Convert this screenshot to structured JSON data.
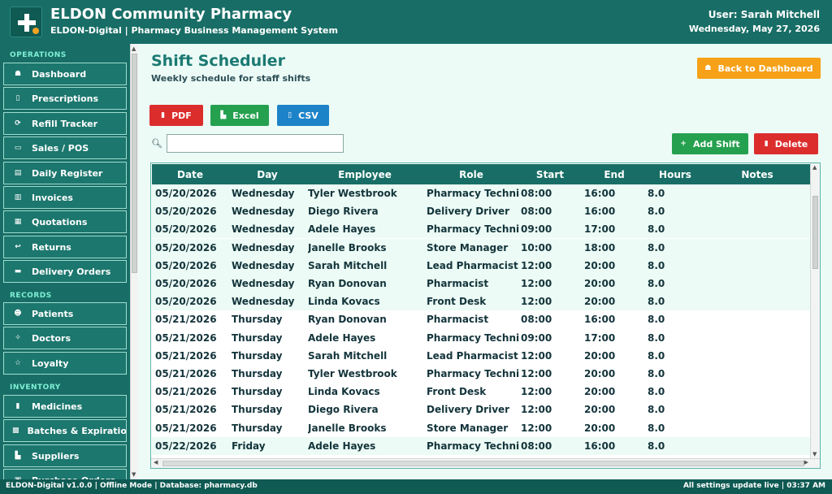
{
  "header": {
    "title": "ELDON Community Pharmacy",
    "subtitle": "ELDON-Digital  |  Pharmacy Business Management System",
    "user": "User: Sarah Mitchell",
    "date": "Wednesday, May 27, 2026"
  },
  "sidebar": {
    "sections": [
      {
        "label": "OPERATIONS",
        "items": [
          {
            "label": "Dashboard",
            "icon": "home-icon",
            "glyph": "☗"
          },
          {
            "label": "Prescriptions",
            "icon": "clipboard-icon",
            "glyph": "▯"
          },
          {
            "label": "Refill Tracker",
            "icon": "refresh-icon",
            "glyph": "⟳"
          },
          {
            "label": "Sales / POS",
            "icon": "register-icon",
            "glyph": "▭"
          },
          {
            "label": "Daily Register",
            "icon": "book-icon",
            "glyph": "▤"
          },
          {
            "label": "Invoices",
            "icon": "invoice-icon",
            "glyph": "▥"
          },
          {
            "label": "Quotations",
            "icon": "quote-icon",
            "glyph": "▦"
          },
          {
            "label": "Returns",
            "icon": "return-arrow-icon",
            "glyph": "↩"
          },
          {
            "label": "Delivery Orders",
            "icon": "truck-icon",
            "glyph": "▬"
          }
        ]
      },
      {
        "label": "RECORDS",
        "items": [
          {
            "label": "Patients",
            "icon": "users-icon",
            "glyph": "☻"
          },
          {
            "label": "Doctors",
            "icon": "stethoscope-icon",
            "glyph": "✧"
          },
          {
            "label": "Loyalty",
            "icon": "star-icon",
            "glyph": "☆"
          }
        ]
      },
      {
        "label": "INVENTORY",
        "items": [
          {
            "label": "Medicines",
            "icon": "pill-icon",
            "glyph": "▮"
          },
          {
            "label": "Batches & Expiration",
            "icon": "boxes-icon",
            "glyph": "▩"
          },
          {
            "label": "Suppliers",
            "icon": "chart-icon",
            "glyph": "▙"
          },
          {
            "label": "Purchase Orders",
            "icon": "cart-icon",
            "glyph": "▣"
          }
        ]
      }
    ]
  },
  "main": {
    "title": "Shift Scheduler",
    "subtitle": "Weekly schedule for staff shifts",
    "back_label": "Back to Dashboard",
    "export": {
      "pdf": "PDF",
      "excel": "Excel",
      "csv": "CSV"
    },
    "search": {
      "value": "",
      "placeholder": ""
    },
    "add_label": "Add Shift",
    "delete_label": "Delete"
  },
  "table": {
    "columns": [
      "Date",
      "Day",
      "Employee",
      "Role",
      "Start",
      "End",
      "Hours",
      "Notes"
    ],
    "rows": [
      [
        "05/20/2026",
        "Wednesday",
        "Tyler Westbrook",
        "Pharmacy Technician",
        "08:00",
        "16:00",
        "8.0",
        ""
      ],
      [
        "05/20/2026",
        "Wednesday",
        "Diego Rivera",
        "Delivery Driver",
        "08:00",
        "16:00",
        "8.0",
        ""
      ],
      [
        "05/20/2026",
        "Wednesday",
        "Adele Hayes",
        "Pharmacy Technician",
        "09:00",
        "17:00",
        "8.0",
        ""
      ],
      [
        "05/20/2026",
        "Wednesday",
        "Janelle Brooks",
        "Store Manager",
        "10:00",
        "18:00",
        "8.0",
        ""
      ],
      [
        "05/20/2026",
        "Wednesday",
        "Sarah Mitchell",
        "Lead Pharmacist",
        "12:00",
        "20:00",
        "8.0",
        ""
      ],
      [
        "05/20/2026",
        "Wednesday",
        "Ryan Donovan",
        "Pharmacist",
        "12:00",
        "20:00",
        "8.0",
        ""
      ],
      [
        "05/20/2026",
        "Wednesday",
        "Linda Kovacs",
        "Front Desk",
        "12:00",
        "20:00",
        "8.0",
        ""
      ],
      [
        "05/21/2026",
        "Thursday",
        "Ryan Donovan",
        "Pharmacist",
        "08:00",
        "16:00",
        "8.0",
        ""
      ],
      [
        "05/21/2026",
        "Thursday",
        "Adele Hayes",
        "Pharmacy Technician",
        "09:00",
        "17:00",
        "8.0",
        ""
      ],
      [
        "05/21/2026",
        "Thursday",
        "Sarah Mitchell",
        "Lead Pharmacist",
        "12:00",
        "20:00",
        "8.0",
        ""
      ],
      [
        "05/21/2026",
        "Thursday",
        "Tyler Westbrook",
        "Pharmacy Technician",
        "12:00",
        "20:00",
        "8.0",
        ""
      ],
      [
        "05/21/2026",
        "Thursday",
        "Linda Kovacs",
        "Front Desk",
        "12:00",
        "20:00",
        "8.0",
        ""
      ],
      [
        "05/21/2026",
        "Thursday",
        "Diego Rivera",
        "Delivery Driver",
        "12:00",
        "20:00",
        "8.0",
        ""
      ],
      [
        "05/21/2026",
        "Thursday",
        "Janelle Brooks",
        "Store Manager",
        "12:00",
        "20:00",
        "8.0",
        ""
      ],
      [
        "05/22/2026",
        "Friday",
        "Adele Hayes",
        "Pharmacy Technician",
        "08:00",
        "16:00",
        "8.0",
        ""
      ]
    ]
  },
  "status": {
    "left": "ELDON-Digital v1.0.0  |  Offline Mode  |  Database: pharmacy.db",
    "right": "All settings update live   |   03:37 AM"
  },
  "colors": {
    "header": "#186e66",
    "accent_teal": "#1b7a73",
    "orange": "#f6a117",
    "red": "#dc2d2d",
    "green": "#25a04f",
    "blue": "#1d83c8",
    "row_alt": "#ecfbf5"
  }
}
